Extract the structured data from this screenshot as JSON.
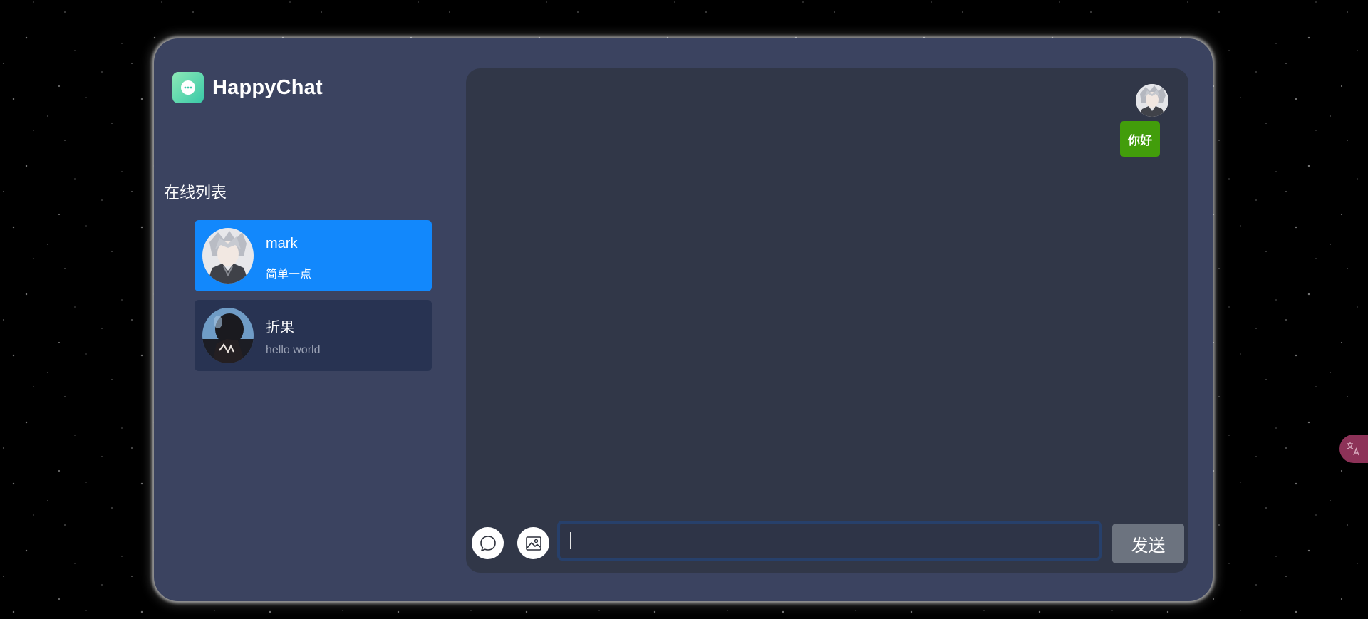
{
  "app": {
    "title": "HappyChat",
    "logo_icon": "chat-bubble-icon",
    "accent_color": "#1288fc"
  },
  "sidebar": {
    "online_list_title": "在线列表",
    "users": [
      {
        "name": "mark",
        "signature": "简单一点",
        "active": true,
        "avatar": "user-avatar-image"
      },
      {
        "name": "折果",
        "signature": "hello world",
        "active": false,
        "avatar": "user-avatar-image"
      }
    ]
  },
  "chat": {
    "messages": [
      {
        "from": "self",
        "text": "你好",
        "bubble_color": "#429d0b"
      }
    ],
    "input": {
      "value": "",
      "placeholder": ""
    },
    "toolbar": {
      "emoji_icon": "chat-bubble-icon",
      "image_icon": "image-icon"
    },
    "send_label": "发送"
  },
  "floating": {
    "translate_icon": "translate-icon"
  }
}
